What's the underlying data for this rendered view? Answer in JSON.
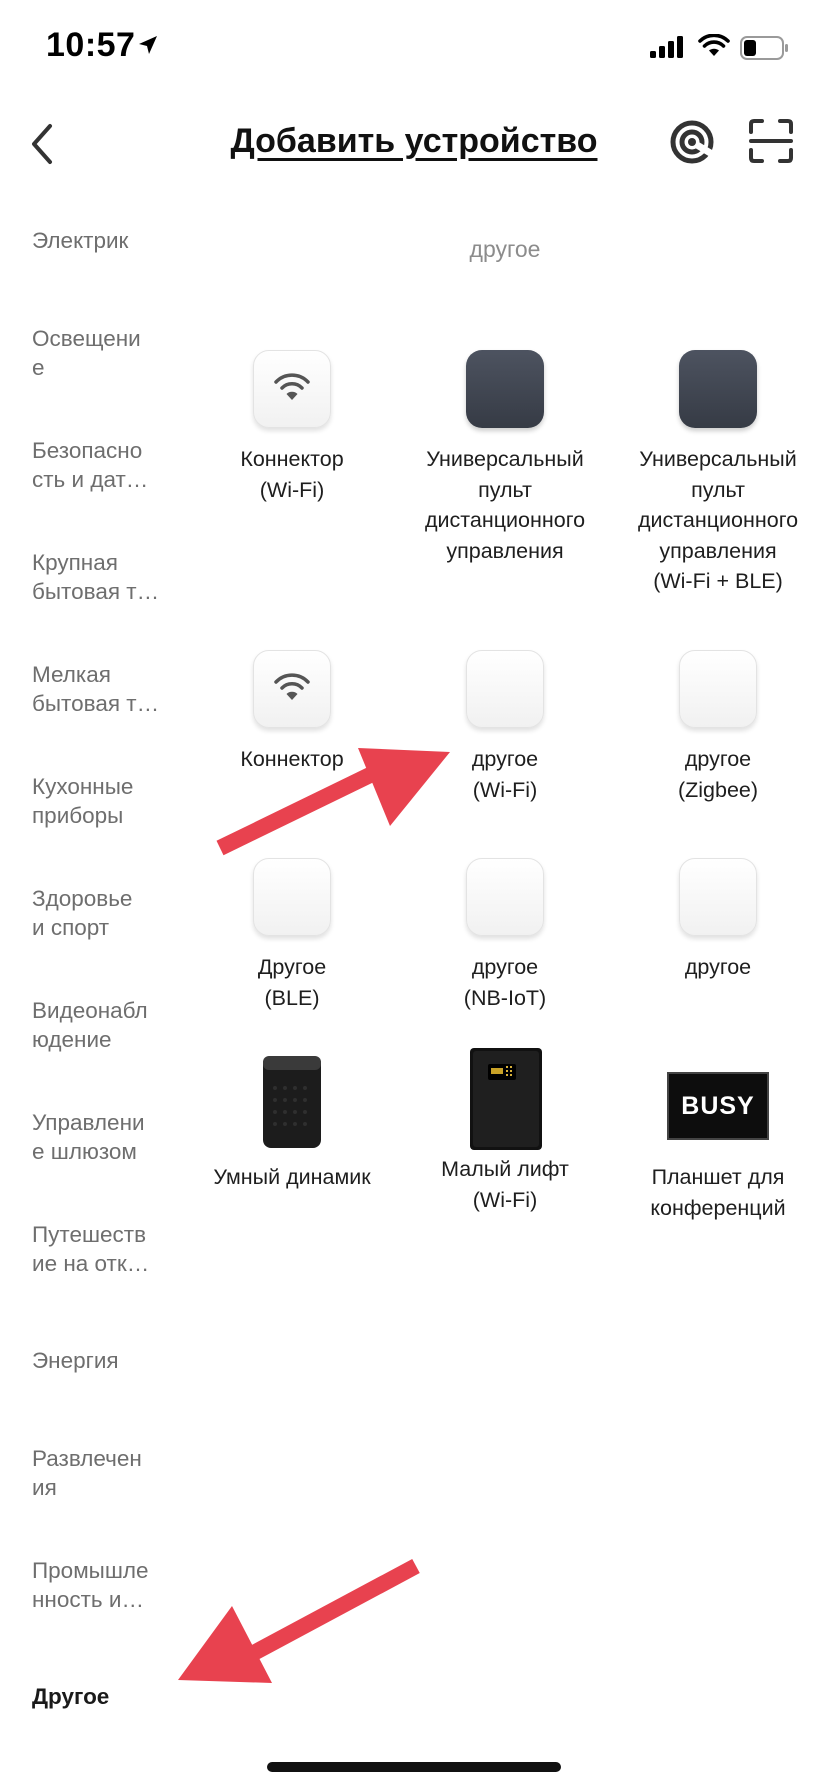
{
  "status_bar": {
    "time": "10:57"
  },
  "header": {
    "title": "Добавить устройство"
  },
  "sidebar": {
    "items": [
      {
        "label": "Электрик"
      },
      {
        "label": "Освещение",
        "line1": "Освещени",
        "line2": "е"
      },
      {
        "label": "Безопасность и датчики",
        "line1": "Безопасно",
        "line2": "сть и дат…"
      },
      {
        "label": "Крупная бытовая техника",
        "line1": "Крупная",
        "line2": "бытовая т…"
      },
      {
        "label": "Мелкая бытовая техника",
        "line1": "Мелкая",
        "line2": "бытовая т…"
      },
      {
        "label": "Кухонные приборы",
        "line1": "Кухонные",
        "line2": "приборы"
      },
      {
        "label": "Здоровье и спорт",
        "line1": "Здоровье",
        "line2": "и спорт"
      },
      {
        "label": "Видеонаблюдение",
        "line1": "Видеонабл",
        "line2": "юдение"
      },
      {
        "label": "Управление шлюзом",
        "line1": "Управлени",
        "line2": "е шлюзом"
      },
      {
        "label": "Путешествие на открытом воздухе",
        "line1": "Путешеств",
        "line2": "ие на отк…"
      },
      {
        "label": "Энергия"
      },
      {
        "label": "Развлечения",
        "line1": "Развлечен",
        "line2": "ия"
      },
      {
        "label": "Промышленность и сельское хозяйство",
        "line1": "Промышле",
        "line2": "нность и…"
      },
      {
        "label": "Другое",
        "active": true
      }
    ]
  },
  "main": {
    "section_title": "другое",
    "devices": [
      {
        "line1": "Коннектор",
        "line2": "(Wi-Fi)",
        "icon": "wifi-icon"
      },
      {
        "line1": "Универсальный",
        "line2": "пульт",
        "line3": "дистанционного",
        "line4": "управления",
        "icon": "remote-control-icon"
      },
      {
        "line1": "Универсальный",
        "line2": "пульт",
        "line3": "дистанционного",
        "line4": "управления",
        "line5": "(Wi-Fi + BLE)",
        "icon": "remote-control-icon"
      },
      {
        "line1": "Коннектор",
        "icon": "wifi-icon"
      },
      {
        "line1": "другое",
        "line2": "(Wi-Fi)",
        "icon": "blank-device-icon"
      },
      {
        "line1": "другое",
        "line2": "(Zigbee)",
        "icon": "blank-device-icon"
      },
      {
        "line1": "Другое",
        "line2": "(BLE)",
        "icon": "blank-device-icon"
      },
      {
        "line1": "другое",
        "line2": "(NB-IoT)",
        "icon": "blank-device-icon"
      },
      {
        "line1": "другое",
        "icon": "blank-device-icon"
      },
      {
        "line1": "Умный динамик",
        "icon": "smart-speaker-icon"
      },
      {
        "line1": "Малый лифт",
        "line2": "(Wi-Fi)",
        "icon": "safe-box-icon"
      },
      {
        "line1": "Планшет для",
        "line2": "конференций",
        "icon": "busy-sign-icon",
        "icon_text": "BUSY"
      }
    ]
  },
  "colors": {
    "annotation_arrow": "#e8424f",
    "dark_tile": "#3f4450",
    "sidebar_text": "#6e6e6e"
  }
}
